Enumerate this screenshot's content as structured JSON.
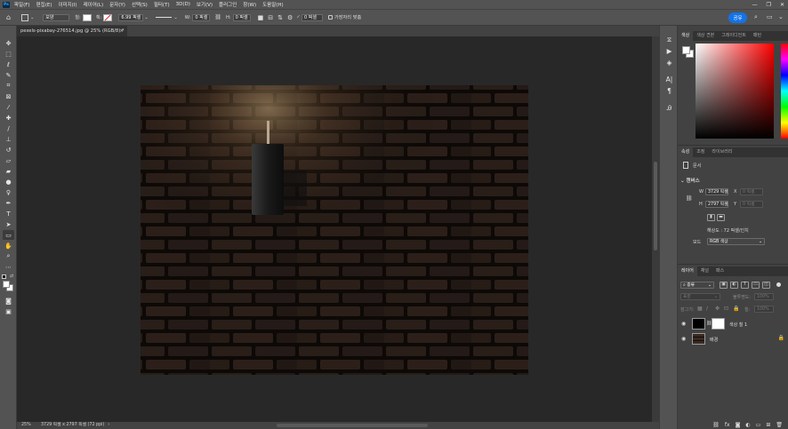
{
  "app": {
    "logo": "Ps"
  },
  "menu": [
    "파일(F)",
    "편집(E)",
    "이미지(I)",
    "레이어(L)",
    "문자(Y)",
    "선택(S)",
    "필터(T)",
    "3D(D)",
    "보기(V)",
    "플러그인",
    "창(W)",
    "도움말(H)"
  ],
  "window_controls": {
    "minimize": "—",
    "restore": "❐",
    "close": "✕"
  },
  "options": {
    "shape_mode": "모양",
    "fill_label": "칠:",
    "stroke_label": "획:",
    "stroke_width": "6.99 픽셀",
    "width_label": "W:",
    "width_value": "0 픽셀",
    "height_label": "H:",
    "height_value": "0 픽셀",
    "radius_value": "0 픽셀",
    "align_edges": "가장자리 맞춤",
    "share_button": "공유",
    "colors": {
      "share": "#1473e6"
    }
  },
  "document": {
    "tab_title": "pexels-pixabay-276514.jpg @ 25% (RGB/8) *",
    "zoom": "25%",
    "status": "3729 픽셀 x 2797 픽셀 (72 ppi)"
  },
  "color_panel": {
    "tabs": [
      "색상",
      "색상 견본",
      "그레이디언트",
      "패턴"
    ],
    "active": 0
  },
  "properties_panel": {
    "tabs": [
      "속성",
      "조정",
      "라이브러리"
    ],
    "active": 0,
    "type_label": "문서",
    "section": "캔버스",
    "w_label": "W",
    "w_value": "3729 픽셀",
    "h_label": "H",
    "h_value": "2797 픽셀",
    "x_label": "X",
    "x_value": "0 픽셀",
    "y_label": "Y",
    "y_value": "0 픽셀",
    "resolution": "해상도 : 72 픽셀/인치",
    "mode_label": "모드",
    "mode_value": "RGB 색상"
  },
  "layers_panel": {
    "tabs": [
      "레이어",
      "채널",
      "패스"
    ],
    "active": 0,
    "filter": "종류",
    "blend_mode": "표준",
    "opacity_label": "불투명도:",
    "opacity_value": "100%",
    "lock_label": "잠그기:",
    "fill_label": "칠:",
    "fill_value": "100%",
    "layers": [
      {
        "name": "색상 칠 1",
        "type": "fill"
      },
      {
        "name": "배경",
        "type": "image",
        "locked": true
      }
    ]
  }
}
